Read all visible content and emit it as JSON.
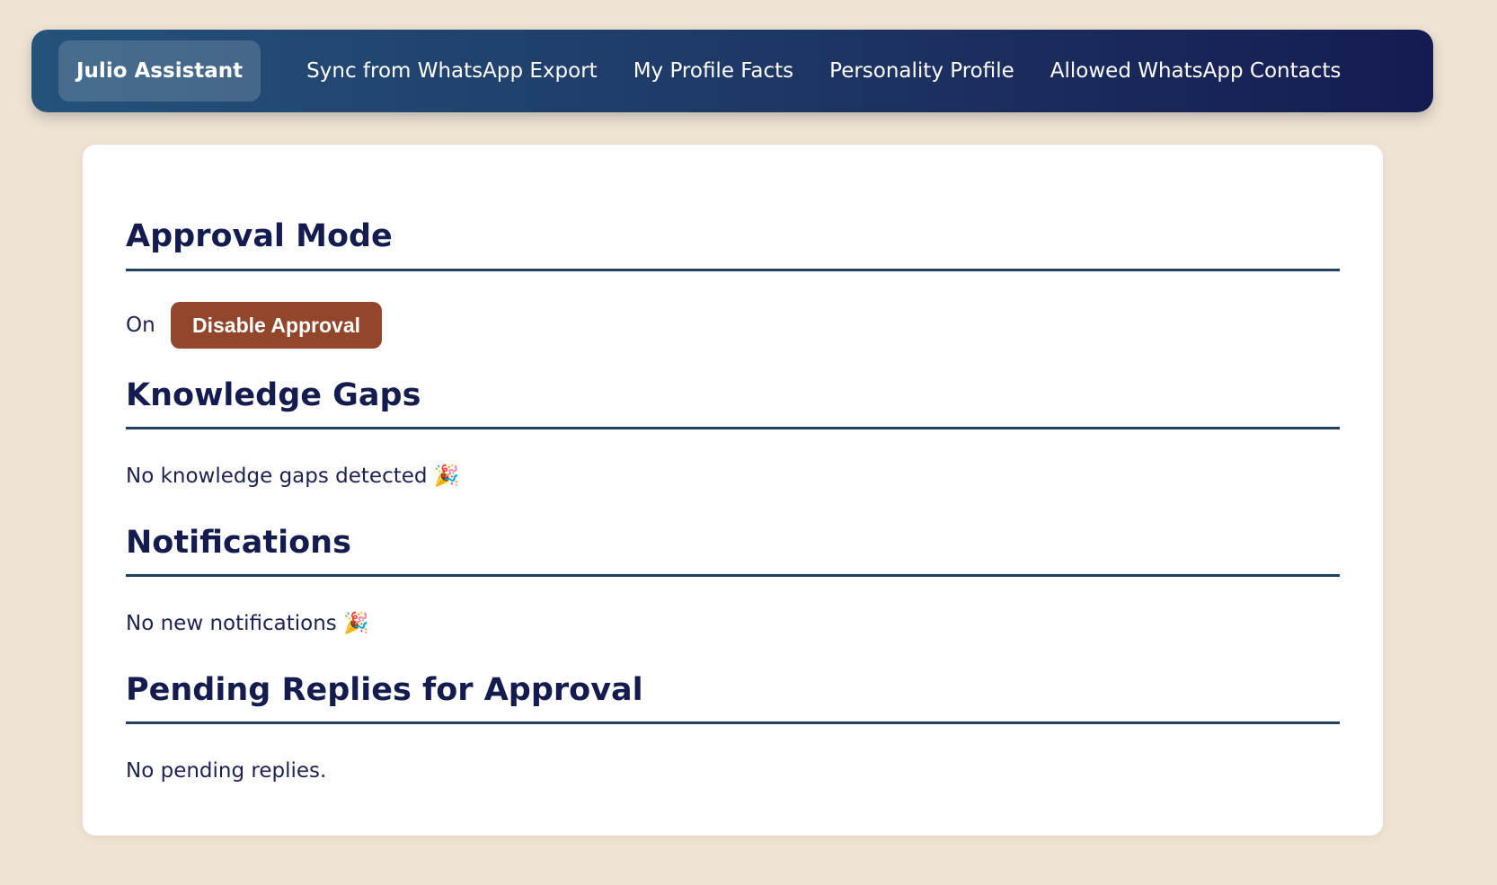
{
  "nav": {
    "brand": "Julio Assistant",
    "links": [
      "Sync from WhatsApp Export",
      "My Profile Facts",
      "Personality Profile",
      "Allowed WhatsApp Contacts"
    ]
  },
  "approval": {
    "title": "Approval Mode",
    "status": "On",
    "button_label": "Disable Approval"
  },
  "knowledge_gaps": {
    "title": "Knowledge Gaps",
    "message": "No knowledge gaps detected 🎉"
  },
  "notifications": {
    "title": "Notifications",
    "message": "No new notifications 🎉"
  },
  "pending_replies": {
    "title": "Pending Replies for Approval",
    "message": "No pending replies."
  },
  "colors": {
    "page_background": "#efe4d3",
    "nav_gradient_start": "#24527a",
    "nav_gradient_end": "#151b50",
    "heading": "#141c4f",
    "rule": "#1e3f66",
    "danger_button": "#92472c"
  },
  "icons": [
    "party-popper-icon"
  ]
}
